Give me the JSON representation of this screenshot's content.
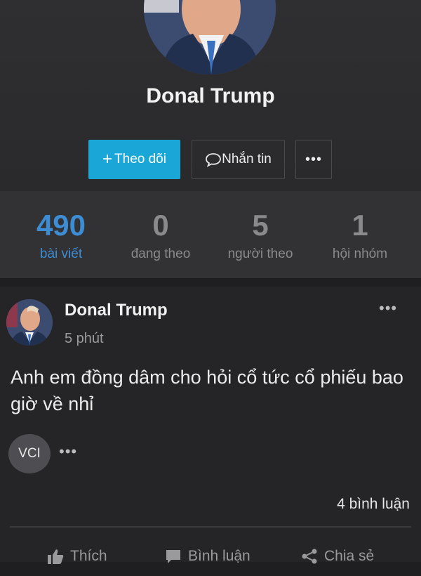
{
  "profile": {
    "name": "Donal Trump",
    "follow_label": "Theo dõi",
    "message_label": "Nhắn tin",
    "more_label": "•••"
  },
  "stats": [
    {
      "value": "490",
      "label": "bài viết"
    },
    {
      "value": "0",
      "label": "đang theo"
    },
    {
      "value": "5",
      "label": "người theo"
    },
    {
      "value": "1",
      "label": "hội nhóm"
    }
  ],
  "post": {
    "author": "Donal Trump",
    "time": "5 phút",
    "text": "Anh em đồng dâm cho hỏi cổ tức cổ phiếu bao giờ về nhỉ",
    "tag": "VCI",
    "comments": "4 bình luận",
    "actions": {
      "like": "Thích",
      "comment": "Bình luận",
      "share": "Chia sẻ"
    }
  },
  "colors": {
    "accent": "#1aa7d8",
    "active_stat": "#3d8dd4"
  }
}
